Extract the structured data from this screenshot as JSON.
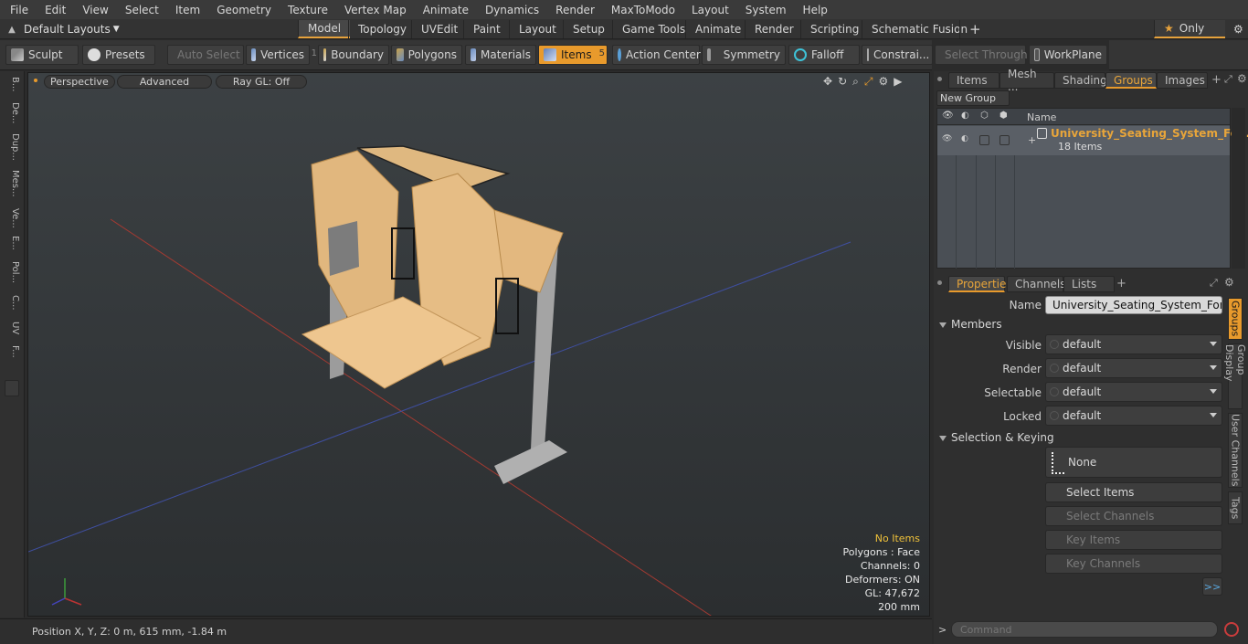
{
  "menu": [
    "File",
    "Edit",
    "View",
    "Select",
    "Item",
    "Geometry",
    "Texture",
    "Vertex Map",
    "Animate",
    "Dynamics",
    "Render",
    "MaxToModo",
    "Layout",
    "System",
    "Help"
  ],
  "layouts_label": "Default Layouts",
  "tabs": [
    "Model",
    "Topology",
    "UVEdit",
    "Paint",
    "Layout",
    "Setup",
    "Game Tools",
    "Animate",
    "Render",
    "Scripting",
    "Schematic Fusion"
  ],
  "only_label": "Only",
  "toolbar": {
    "sculpt": "Sculpt",
    "presets": "Presets",
    "auto_select": "Auto Select",
    "vertices": "Vertices",
    "vertices_count": "1",
    "boundary": "Boundary",
    "polygons": "Polygons",
    "materials": "Materials",
    "items": "Items",
    "items_count": "5",
    "action_center": "Action Center",
    "symmetry": "Symmetry",
    "falloff": "Falloff",
    "constraints": "Constrai...",
    "select_through": "Select Through",
    "workplane": "WorkPlane"
  },
  "left_tabs": [
    "B...",
    "De...",
    "Dup...",
    "Mes...",
    "Ve...",
    "E...",
    "Pol...",
    "C...",
    "UV",
    "F..."
  ],
  "viewport": {
    "perspective": "Perspective",
    "advanced": "Advanced",
    "raygl": "Ray GL: Off",
    "info": [
      "No Items",
      "Polygons : Face",
      "Channels: 0",
      "Deformers: ON",
      "GL: 47,672",
      "200 mm"
    ]
  },
  "status": {
    "position": "Position X, Y, Z:   0 m, 615 mm, -1.84 m"
  },
  "items_panel": {
    "tabs": [
      "Items",
      "Mesh ...",
      "Shading",
      "Groups",
      "Images"
    ],
    "new_group": "New Group",
    "col_name": "Name",
    "group_name": "University_Seating_System_For...",
    "group_count": "18 Items"
  },
  "properties": {
    "tabs": [
      "Properties",
      "Channels",
      "Lists"
    ],
    "name_label": "Name",
    "name_value": "University_Seating_System_For_Two_",
    "members_label": "Members",
    "rows": [
      {
        "label": "Visible",
        "value": "default"
      },
      {
        "label": "Render",
        "value": "default"
      },
      {
        "label": "Selectable",
        "value": "default"
      },
      {
        "label": "Locked",
        "value": "default"
      }
    ],
    "selection_keying": "Selection & Keying",
    "none": "None",
    "select_items": "Select Items",
    "select_channels": "Select Channels",
    "key_items": "Key Items",
    "key_channels": "Key Channels",
    "more": ">>",
    "side_tabs": [
      "Groups",
      "Group Display",
      "User Channels",
      "Tags"
    ]
  },
  "command_placeholder": "Command",
  "colors": {
    "accent": "#e89a2c",
    "group_name": "#e8a53a"
  }
}
